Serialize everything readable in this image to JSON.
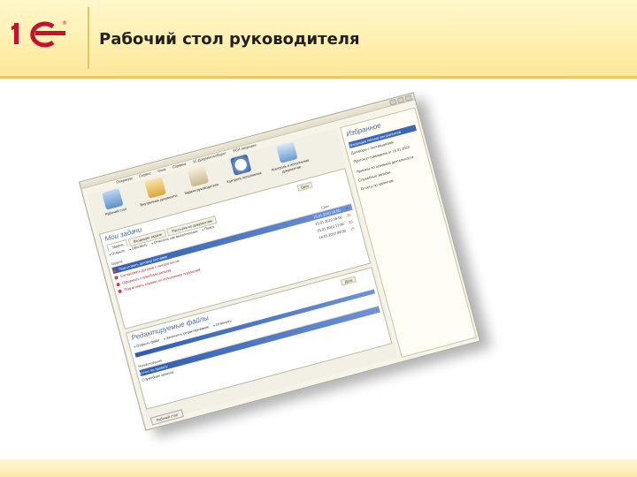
{
  "slide": {
    "title": "Рабочий стол руководителя",
    "brand_color": "#c8102e"
  },
  "app": {
    "menu": [
      "Операции",
      "Сервис",
      "Окна",
      "Справка",
      "1С:Документооборот",
      "РСИ лицензия"
    ],
    "toolbar": [
      {
        "icon": "tasks-icon",
        "label": "Рабочий стол"
      },
      {
        "icon": "documents-icon",
        "label": "Внутренние документы"
      },
      {
        "icon": "list-icon",
        "label": "Задачи руководителя"
      },
      {
        "icon": "clock-icon",
        "label": "Контроль исполнения"
      },
      {
        "icon": "contacts-icon",
        "label": "Контроль и исполнение документов"
      }
    ],
    "tasks": {
      "title": "Мои задачи",
      "tabs": [
        "Задачи",
        "Входящие задачи",
        "Рассылки по документам"
      ],
      "actions": [
        "Открыть",
        "Обновить",
        "Отметить как выполненные",
        "Поиск"
      ],
      "columns": [
        "Задача",
        "Срок"
      ],
      "date_filter": "Срок",
      "rows": [
        {
          "text": "Подготовить договор поставки",
          "date": "15.01.2010 15:00",
          "num": "25",
          "state": "selected"
        },
        {
          "text": "Согласовать договор с контрагентом",
          "date": "15.01.2010 16:00",
          "num": "25",
          "state": "red"
        },
        {
          "text": "Оформить служебную записку",
          "date": "15.01.2010 17:00",
          "num": "25",
          "state": "red"
        },
        {
          "text": "Подготовить справку по исполнению поручений",
          "date": "16.01.2010 09:00",
          "num": "15",
          "state": "red"
        }
      ]
    },
    "files": {
      "title": "Редактируемые файлы",
      "actions": [
        "Открыть файл",
        "Закончить редактирование",
        "Отменить"
      ],
      "date_filter": "Дата",
      "rows": [
        {
          "text": "Наименование",
          "state": "head"
        },
        {
          "text": "Отчет по проекту",
          "state": "selected"
        },
        {
          "text": "Служебная записка",
          "state": "plain"
        }
      ]
    },
    "favorites": {
      "title": "Избранное",
      "items": [
        {
          "text": "Входящие письма контрагентов",
          "state": "selected"
        },
        {
          "text": "Договоры с поставщиками",
          "state": "plain"
        },
        {
          "text": "Протокол совещания от 15.01.2010",
          "state": "plain"
        },
        {
          "text": "Приказы по основной деятельности",
          "state": "plain"
        },
        {
          "text": "Служебные записки",
          "state": "plain"
        },
        {
          "text": "Отчеты по проектам",
          "state": "plain"
        }
      ]
    },
    "status_button": "Рабочий стол"
  }
}
